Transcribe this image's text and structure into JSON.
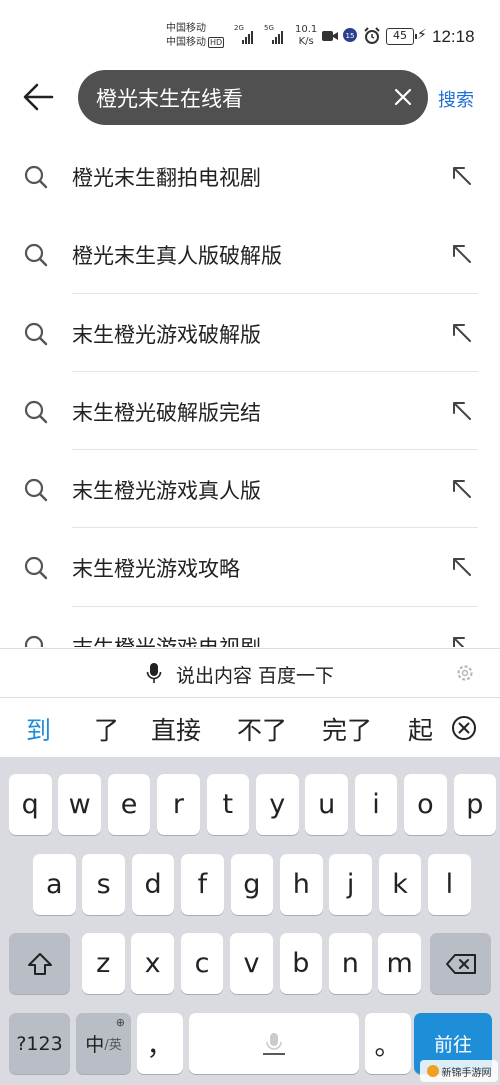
{
  "status_bar": {
    "carrier1": "中国移动",
    "carrier2": "中国移动",
    "hd_badge": "HD",
    "sig1_label": "2G",
    "sig2_label": "5G",
    "net_speed": "10.1",
    "net_unit": "K/s",
    "battery": "45",
    "time": "12:18",
    "icons": [
      "video-icon",
      "badge-icon",
      "alarm-icon",
      "mute-icon",
      "battery-icon",
      "charging-icon"
    ]
  },
  "search": {
    "query": "橙光末生在线看",
    "submit_label": "搜索",
    "accent_color": "#1e6fd6"
  },
  "suggestions": [
    "橙光末生翻拍电视剧",
    "橙光末生真人版破解版",
    "末生橙光游戏破解版",
    "末生橙光破解版完结",
    "末生橙光游戏真人版",
    "末生橙光游戏攻略",
    "末生橙光游戏电视剧"
  ],
  "voice_bar": {
    "label": "说出内容 百度一下"
  },
  "candidates": [
    "到",
    "了",
    "直接",
    "不了",
    "完了",
    "起"
  ],
  "keyboard": {
    "row1": [
      "q",
      "w",
      "e",
      "r",
      "t",
      "y",
      "u",
      "i",
      "o",
      "p"
    ],
    "row2": [
      "a",
      "s",
      "d",
      "f",
      "g",
      "h",
      "j",
      "k",
      "l"
    ],
    "row3": [
      "z",
      "x",
      "c",
      "v",
      "b",
      "n",
      "m"
    ],
    "numbers_key": "?123",
    "lang_key_main": "中",
    "lang_key_sub": "/英",
    "comma_key": "，",
    "period_key": "。",
    "enter_key": "前往",
    "enter_color": "#1e8ed8"
  },
  "watermark": {
    "text": "新锦手游网"
  }
}
